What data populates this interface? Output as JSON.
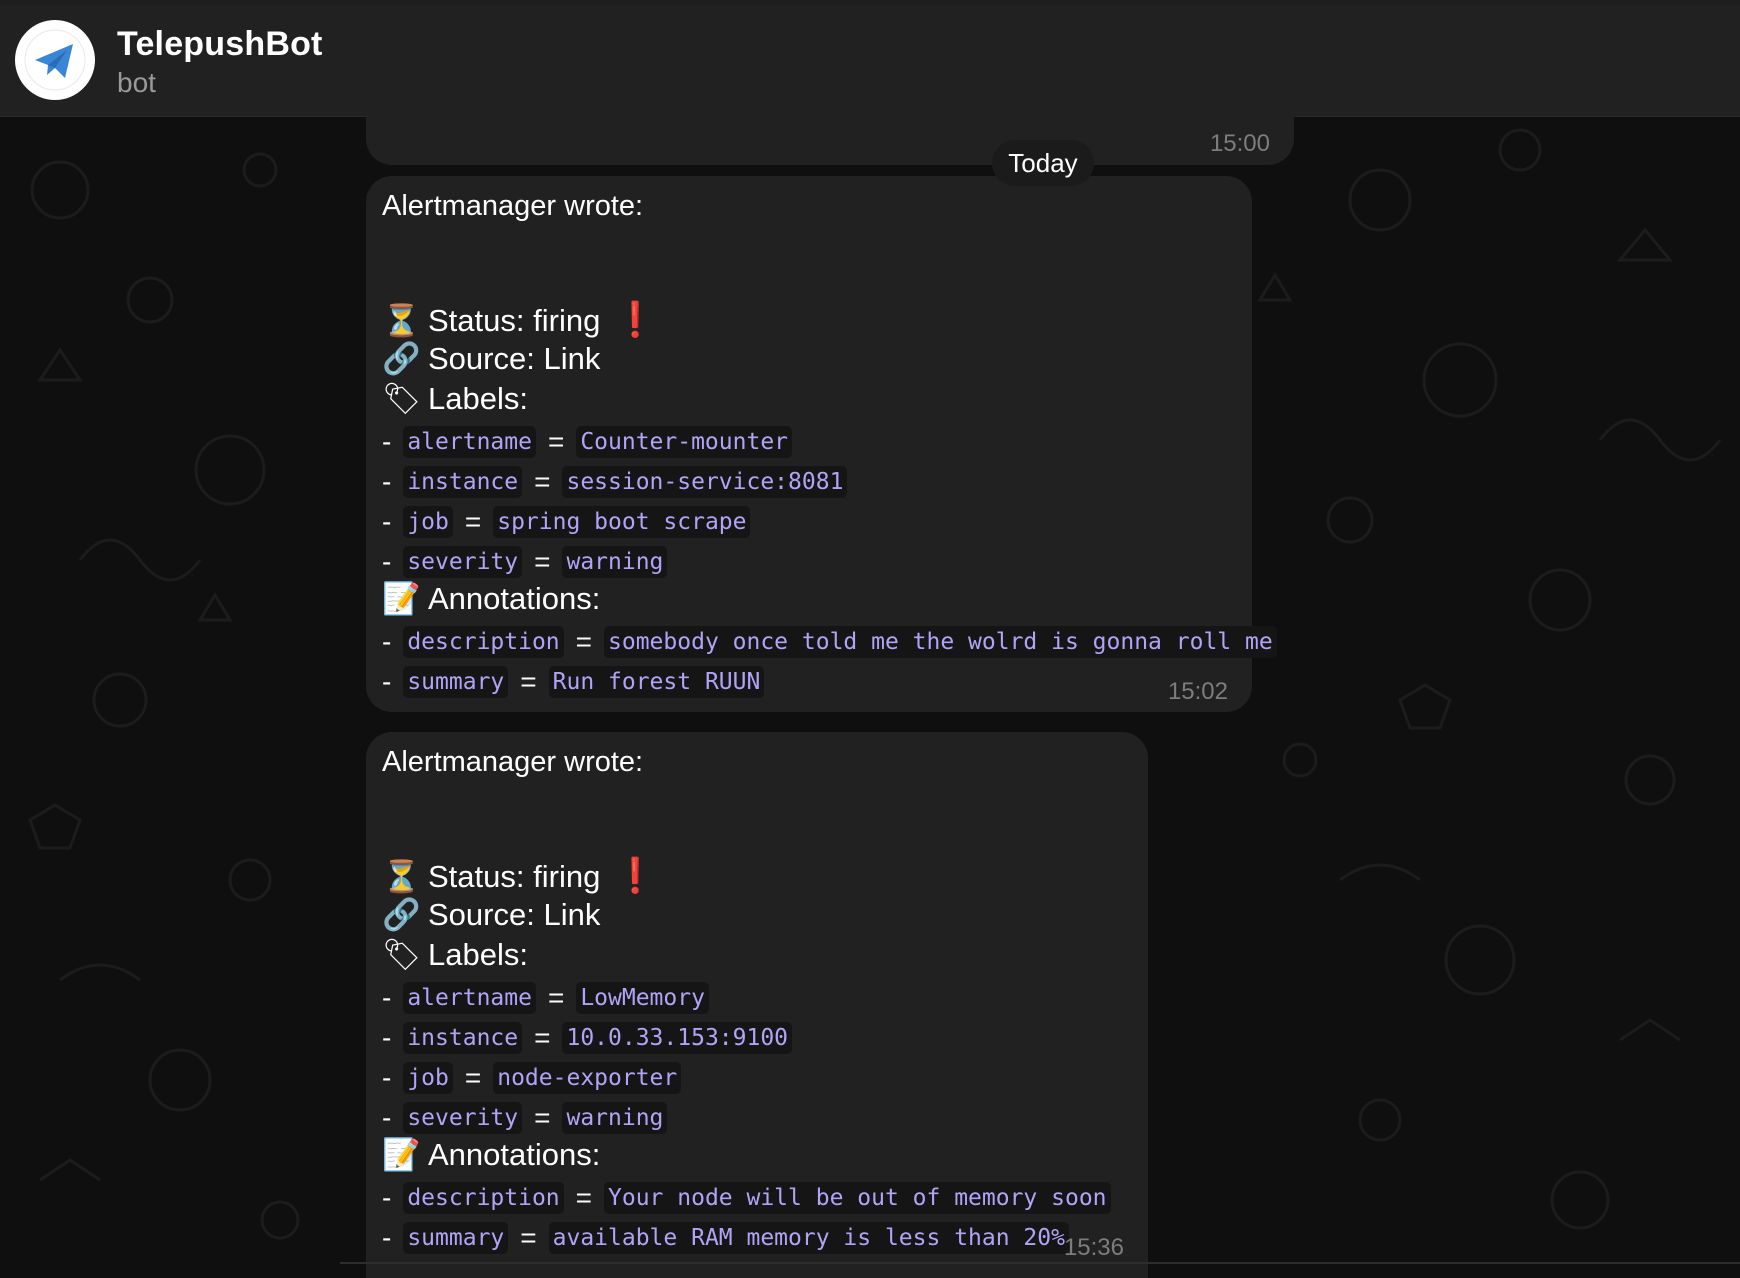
{
  "chat": {
    "title": "TelepushBot",
    "status": "bot",
    "avatar_icon": "telegram-paper-plane-icon"
  },
  "previous_message": {
    "time": "15:00"
  },
  "date_separator": "Today",
  "messages": [
    {
      "header": "Alertmanager wrote:",
      "status_label": "Status:",
      "status_value": "firing",
      "status_mark": "❗",
      "source_label": "Source:",
      "source_value": "Link",
      "labels_title": "Labels:",
      "labels": [
        {
          "key": "alertname",
          "value": "Counter-mounter"
        },
        {
          "key": "instance",
          "value": "session-service:8081"
        },
        {
          "key": "job",
          "value": "spring boot scrape"
        },
        {
          "key": "severity",
          "value": "warning"
        }
      ],
      "annotations_title": "Annotations:",
      "annotations": [
        {
          "key": "description",
          "value": "somebody once told me the wolrd is gonna roll me"
        },
        {
          "key": "summary",
          "value": "Run forest RUUN"
        }
      ],
      "time": "15:02"
    },
    {
      "header": "Alertmanager wrote:",
      "status_label": "Status:",
      "status_value": "firing",
      "status_mark": "❗",
      "source_label": "Source:",
      "source_value": "Link",
      "labels_title": "Labels:",
      "labels": [
        {
          "key": "alertname",
          "value": "LowMemory"
        },
        {
          "key": "instance",
          "value": "10.0.33.153:9100"
        },
        {
          "key": "job",
          "value": "node-exporter"
        },
        {
          "key": "severity",
          "value": "warning"
        }
      ],
      "annotations_title": "Annotations:",
      "annotations": [
        {
          "key": "description",
          "value": "Your node will be out of memory soon"
        },
        {
          "key": "summary",
          "value": "available RAM memory is less than 20%"
        }
      ],
      "time": "15:36"
    }
  ],
  "icons": {
    "status": "hourglass-icon",
    "source": "link-icon",
    "labels": "tag-icon",
    "annotations": "memo-icon"
  },
  "colors": {
    "background": "#0f0f0f",
    "header": "#212121",
    "bubble": "#212121",
    "code_text": "#b1a4f7",
    "code_bg": "#151515",
    "alert_red": "#e0261b",
    "timestamp": "#7d7d7d"
  }
}
